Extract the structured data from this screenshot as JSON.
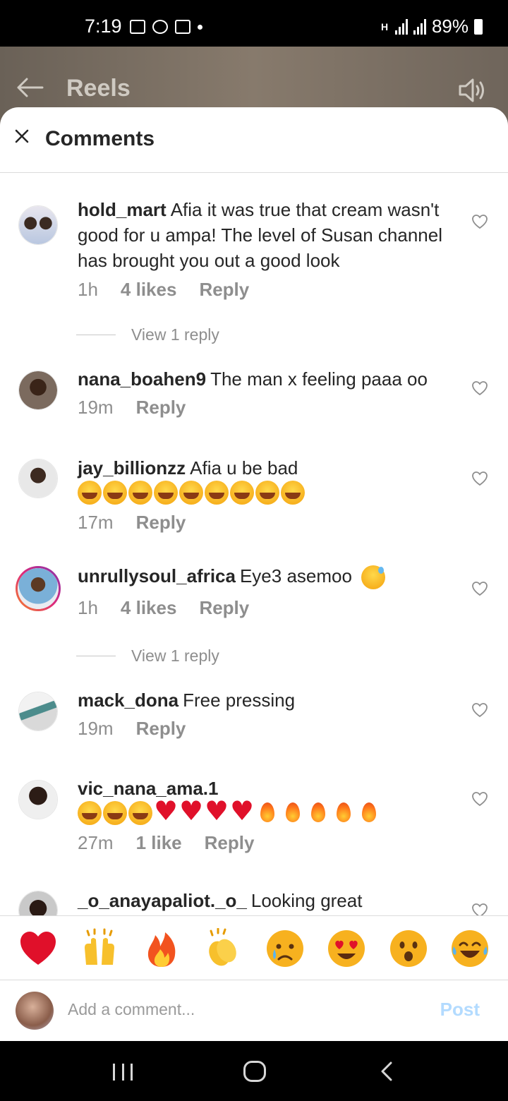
{
  "status_bar": {
    "time": "7:19",
    "battery": "89%",
    "network_label": "H"
  },
  "header": {
    "title": "Reels"
  },
  "sheet": {
    "title": "Comments"
  },
  "comments": [
    {
      "username": "hold_mart",
      "text": "Afia it was true that cream wasn't good for u ampa! The level of Susan channel has brought you out a good look",
      "time": "1h",
      "likes": "4 likes",
      "reply_label": "Reply",
      "view_replies": "View 1 reply"
    },
    {
      "username": "nana_boahen9",
      "text": "The man x feeling paaa oo",
      "time": "19m",
      "reply_label": "Reply"
    },
    {
      "username": "jay_billionzz",
      "text": "Afia u be bad",
      "time": "17m",
      "reply_label": "Reply",
      "emoji": [
        "laugh",
        "laugh",
        "laugh",
        "laugh",
        "laugh",
        "laugh",
        "laugh",
        "laugh",
        "laugh"
      ]
    },
    {
      "username": "unrullysoul_africa",
      "text": "Eye3 asemoo",
      "time": "1h",
      "likes": "4 likes",
      "reply_label": "Reply",
      "view_replies": "View 1 reply"
    },
    {
      "username": "mack_dona",
      "text": "Free pressing",
      "time": "19m",
      "reply_label": "Reply"
    },
    {
      "username": "vic_nana_ama.1",
      "text": "",
      "time": "27m",
      "likes": "1 like",
      "reply_label": "Reply"
    },
    {
      "username": "_o_anayapaliot._o_",
      "text": "Looking great"
    }
  ],
  "quick_reactions": [
    "red-heart",
    "raising-hands",
    "fire",
    "clapping-hands",
    "crying-face",
    "heart-eyes",
    "surprised-face",
    "tears-of-joy"
  ],
  "composer": {
    "placeholder": "Add a comment...",
    "post_label": "Post"
  },
  "colors": {
    "accent_disabled": "#b3dbff",
    "secondary_text": "#8e8e8e",
    "heart_red": "#e0102a"
  }
}
